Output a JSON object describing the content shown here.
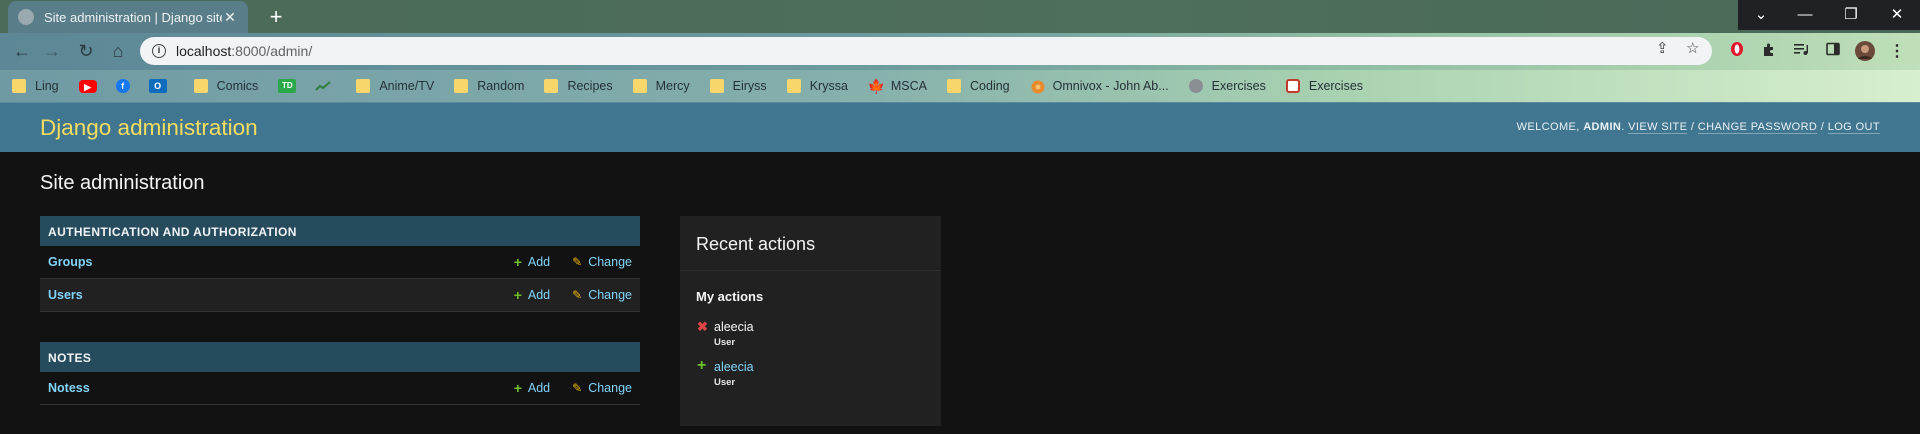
{
  "browser": {
    "tab_title": "Site administration | Django site",
    "tab_close": "✕",
    "new_tab": "+",
    "url_host": "localhost",
    "url_path": ":8000/admin/",
    "window_controls": {
      "collapse": "⌄",
      "minimize": "—",
      "restore": "❐",
      "close": "✕"
    },
    "nav": {
      "back": "←",
      "forward": "→",
      "reload": "↻",
      "home": "⌂"
    },
    "omnibox_icons": {
      "share": "⇪",
      "star": "☆"
    },
    "extensions": [
      "opera-icon",
      "puzzle-icon",
      "media-queue-icon",
      "side-panel-icon",
      "profile-avatar",
      "kebab-menu-icon"
    ],
    "bookmarks": [
      {
        "label": "Ling",
        "icon": "folder"
      },
      {
        "label": "",
        "icon": "youtube",
        "color": "#ff0000"
      },
      {
        "label": "",
        "icon": "facebook",
        "color": "#1877f2"
      },
      {
        "label": "",
        "icon": "outlook",
        "color": "#0f6cbd"
      },
      {
        "label": "Comics",
        "icon": "folder"
      },
      {
        "label": "",
        "icon": "td",
        "color": "#2ba84a"
      },
      {
        "label": "",
        "icon": "stock-chart",
        "color": "#3a7d44"
      },
      {
        "label": "Anime/TV",
        "icon": "folder"
      },
      {
        "label": "Random",
        "icon": "folder"
      },
      {
        "label": "Recipes",
        "icon": "folder"
      },
      {
        "label": "Mercy",
        "icon": "folder"
      },
      {
        "label": "Eiryss",
        "icon": "folder"
      },
      {
        "label": "Kryssa",
        "icon": "folder"
      },
      {
        "label": "MSCA",
        "icon": "maple-leaf",
        "color": "#d52b1e"
      },
      {
        "label": "Coding",
        "icon": "folder"
      },
      {
        "label": "Omnivox - John Ab...",
        "icon": "omnivox",
        "color": "#e88a2e"
      },
      {
        "label": "Exercises",
        "icon": "globe",
        "color": "#8a8f94"
      },
      {
        "label": "Exercises",
        "icon": "exercises",
        "color": "#c0392b"
      }
    ]
  },
  "admin": {
    "branding": "Django administration",
    "usertools": {
      "welcome": "Welcome,",
      "user": "admin",
      "view_site": "View site",
      "change_password": "Change password",
      "log_out": "Log out",
      "sep": "/"
    },
    "page_title": "Site administration",
    "apps": [
      {
        "caption": "Authentication and Authorization",
        "models": [
          {
            "name": "Groups",
            "add": "Add",
            "change": "Change"
          },
          {
            "name": "Users",
            "add": "Add",
            "change": "Change"
          }
        ]
      },
      {
        "caption": "Notes",
        "models": [
          {
            "name": "Notess",
            "add": "Add",
            "change": "Change"
          }
        ]
      }
    ],
    "recent_actions": {
      "title": "Recent actions",
      "subtitle": "My actions",
      "items": [
        {
          "action": "deletion",
          "mark": "✖",
          "mark_color": "#dd4646",
          "name": "aleecia",
          "type": "User",
          "is_link": false
        },
        {
          "action": "addition",
          "mark": "+",
          "mark_color": "#70bf2b",
          "name": "aleecia",
          "type": "User",
          "is_link": true
        }
      ]
    }
  },
  "colors": {
    "header_bg": "#417690",
    "branding": "#f5dd5d",
    "caption_bg": "#264b5d",
    "link": "#81d4fa",
    "add_icon": "#70bf2b",
    "change_icon": "#efb80b",
    "body_bg": "#121212"
  }
}
